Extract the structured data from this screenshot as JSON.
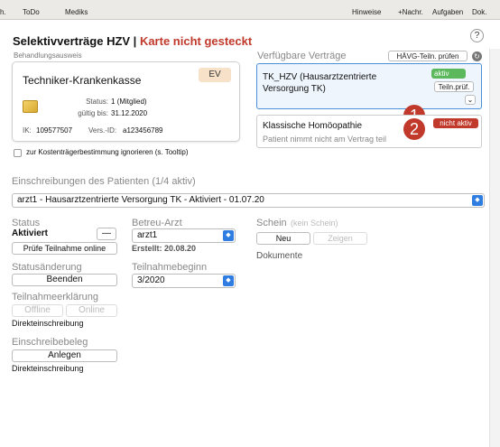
{
  "toolbar": {
    "items": [
      "h.",
      "ToDo",
      "Mediks",
      "Hinweise",
      "+Nachr.",
      "Aufgaben",
      "Dok."
    ]
  },
  "title": {
    "main": "Selektivverträge HZV | ",
    "status": "Karte nicht gesteckt"
  },
  "help": "?",
  "card": {
    "section": "Behandlungsausweis",
    "insurer": "Techniker-Krankenkasse",
    "ev": "EV",
    "status_label": "Status:",
    "status_value": "1 (Mitglied)",
    "valid_label": "gültig bis:",
    "valid_value": "31.12.2020",
    "ik_label": "IK:",
    "ik_value": "109577507",
    "vers_label": "Vers.-ID:",
    "vers_value": "a123456789"
  },
  "checkbox_label": "zur Kostenträgerbestimmung ignorieren (s. Tooltip)",
  "contracts": {
    "header": "Verfügbare Verträge",
    "check_button": "HÄVG-Teiln. prüfen",
    "items": [
      {
        "name": "TK_HZV (Hausarztzentrierte Versorgung TK)",
        "badge": "aktiv",
        "badge_color": "#5cb85c",
        "action": "Teiln.prüf.",
        "marker": "1"
      },
      {
        "name": "Klassische Homöopathie",
        "note": "Patient nimmt nicht am Vertrag teil",
        "badge": "nicht aktiv",
        "badge_color": "#c0392b",
        "marker": "2"
      }
    ]
  },
  "enrollments": {
    "header": "Einschreibungen des Patienten (1/4 aktiv)",
    "selected": "arzt1 - Hausarztzentrierte Versorgung TK - Aktiviert - 01.07.20"
  },
  "status": {
    "label": "Status",
    "value": "Aktiviert",
    "minus": "—",
    "check_online": "Prüfe Teilnahme online"
  },
  "betreu": {
    "label": "Betreu-Arzt",
    "value": "arzt1",
    "created": "Erstellt: 20.08.20"
  },
  "schein": {
    "label": "Schein",
    "sublabel": "(kein Schein)",
    "new": "Neu",
    "show": "Zeigen",
    "docs": "Dokumente"
  },
  "change": {
    "label": "Statusänderung",
    "button": "Beenden"
  },
  "begin": {
    "label": "Teilnahmebeginn",
    "value": "3/2020"
  },
  "declaration": {
    "label": "Teilnahmeerklärung",
    "offline": "Offline",
    "online": "Online",
    "direct": "Direkteinschreibung"
  },
  "receipt": {
    "label": "Einschreibebeleg",
    "button": "Anlegen",
    "direct": "Direkteinschreibung"
  }
}
